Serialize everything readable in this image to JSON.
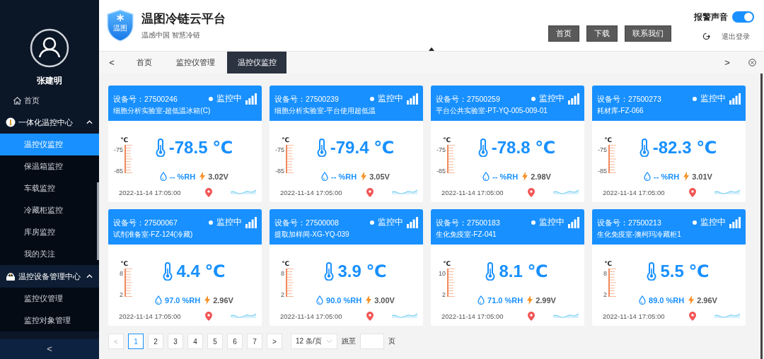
{
  "sidebar": {
    "user_name": "张建明",
    "menu": [
      {
        "kind": "link",
        "label": "首页"
      },
      {
        "kind": "group",
        "label": "一体化温控中心",
        "expanded": true,
        "children": [
          {
            "label": "温控仪监控",
            "selected": true
          },
          {
            "label": "保温箱监控",
            "selected": false
          },
          {
            "label": "车载监控",
            "selected": false
          },
          {
            "label": "冷藏柜监控",
            "selected": false
          },
          {
            "label": "库房监控",
            "selected": false
          },
          {
            "label": "我的关注",
            "selected": false
          }
        ]
      },
      {
        "kind": "group",
        "label": "温控设备管理中心",
        "expanded": true,
        "children": [
          {
            "label": "监控仪管理",
            "selected": false
          },
          {
            "label": "监控对象管理",
            "selected": false
          }
        ]
      }
    ],
    "collapse": "<"
  },
  "header": {
    "logo_text": "温图",
    "title": "温图冷链云平台",
    "subtitle": "温感中国 智慧冷链",
    "alarm_sound": {
      "label": "报警声音",
      "on": true
    },
    "buttons": [
      "首页",
      "下载",
      "联系我们"
    ],
    "logout": "退出登录"
  },
  "tabs": {
    "prev": "<",
    "next": ">",
    "items": [
      {
        "label": "首页",
        "selected": false
      },
      {
        "label": "监控仪管理",
        "selected": false
      },
      {
        "label": "温控仪监控",
        "selected": true
      }
    ]
  },
  "devices": [
    {
      "device": "设备号：27500246",
      "location": "细胞分析实验室-超低温冰箱(C)",
      "status": "监控中",
      "unit": "℃",
      "scale": [
        "-75",
        "-85"
      ],
      "temperature": "-78.5 ℃",
      "humidity": "-- %RH",
      "voltage": "3.02V",
      "time": "2022-11-14 17:05:00"
    },
    {
      "device": "设备号：27500239",
      "location": "细胞分析实验室-平台使用超低温",
      "status": "监控中",
      "unit": "℃",
      "scale": [
        "-75",
        "-85"
      ],
      "temperature": "-79.4 ℃",
      "humidity": "-- %RH",
      "voltage": "3.05V",
      "time": "2022-11-14 17:05:00"
    },
    {
      "device": "设备号：27500259",
      "location": "平台公共实验室-PT-YQ-005-009-01",
      "status": "监控中",
      "unit": "℃",
      "scale": [
        "-75",
        "-85"
      ],
      "temperature": "-78.8 ℃",
      "humidity": "-- %RH",
      "voltage": "2.98V",
      "time": "2022-11-14 17:05:00"
    },
    {
      "device": "设备号：27500273",
      "location": "耗材库-FZ-066",
      "status": "监控中",
      "unit": "℃",
      "scale": [
        "-75",
        "-85"
      ],
      "temperature": "-82.3 ℃",
      "humidity": "-- %RH",
      "voltage": "3.01V",
      "time": "2022-11-14 17:05:00"
    },
    {
      "device": "设备号：27500067",
      "location": "试剂准备室-FZ-124(冷藏)",
      "status": "监控中",
      "unit": "℃",
      "scale": [
        "8",
        "2"
      ],
      "temperature": "4.4 ℃",
      "humidity": "97.0 %RH",
      "voltage": "2.96V",
      "time": "2022-11-14 17:05:00"
    },
    {
      "device": "设备号：27500008",
      "location": "提取加样间-XG-YQ-039",
      "status": "监控中",
      "unit": "℃",
      "scale": [
        "8",
        "2"
      ],
      "temperature": "3.9 ℃",
      "humidity": "90.0 %RH",
      "voltage": "3.00V",
      "time": "2022-11-14 17:05:00"
    },
    {
      "device": "设备号：27500183",
      "location": "生化免疫室-FZ-041",
      "status": "监控中",
      "unit": "℃",
      "scale": [
        "10",
        "2"
      ],
      "temperature": "8.1 ℃",
      "humidity": "71.0 %RH",
      "voltage": "2.99V",
      "time": "2022-11-14 17:05:00"
    },
    {
      "device": "设备号：27500213",
      "location": "生化免疫室-澳柯玛冷藏柜1",
      "status": "监控中",
      "unit": "℃",
      "scale": [
        "8",
        "2"
      ],
      "temperature": "5.5 ℃",
      "humidity": "89.0 %RH",
      "voltage": "2.96V",
      "time": "2022-11-14 17:05:00"
    }
  ],
  "pagination": {
    "prev": {
      "label": "<",
      "disabled": true
    },
    "pages": [
      {
        "label": "1",
        "selected": true
      },
      {
        "label": "2",
        "selected": false
      },
      {
        "label": "3",
        "selected": false
      },
      {
        "label": "4",
        "selected": false
      },
      {
        "label": "5",
        "selected": false
      },
      {
        "label": "6",
        "selected": false
      },
      {
        "label": "7",
        "selected": false
      }
    ],
    "next": {
      "label": ">",
      "disabled": false
    },
    "page_size": "12 条/页",
    "jump_label": "跳至",
    "page_unit": "页"
  }
}
